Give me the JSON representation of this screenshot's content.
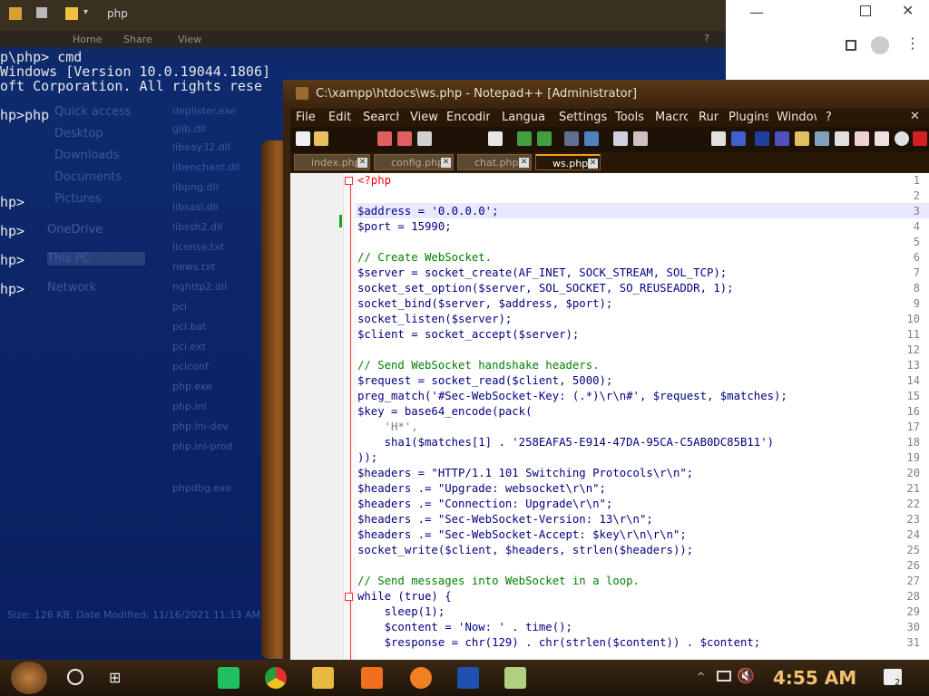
{
  "explorer": {
    "title": "php",
    "ribbon_tabs": [
      "Home",
      "Share",
      "View"
    ],
    "nav_items": [
      "Quick access",
      "Desktop",
      "Downloads",
      "Documents",
      "Pictures",
      "OneDrive",
      "This PC",
      "Network"
    ],
    "files": [
      "deplister.exe",
      "glib.dll",
      "libeay32.dll",
      "libenchant.dll",
      "libpng.dll",
      "libsasl.dll",
      "libssh2.dll",
      "license.txt",
      "news.txt",
      "nghttp2.dll",
      "pci",
      "pci.bat",
      "pci.ext",
      "pciconf",
      "php.exe",
      "php.ini",
      "php.ini-dev",
      "php.ini-prod",
      "phpdbg.exe"
    ],
    "status": "Size: 126 KB, Date Modified: 11/16/2021 11:13 AM"
  },
  "cmd": {
    "lines": [
      "p\\php> cmd",
      "Windows [Version 10.0.19044.1806]",
      "oft Corporation. All rights rese",
      "",
      "hp>php",
      "",
      "",
      "hp>",
      "",
      "hp>",
      "",
      "hp>",
      "",
      "hp>"
    ]
  },
  "npp": {
    "title": "C:\\xampp\\htdocs\\ws.php - Notepad++ [Administrator]",
    "menu": [
      "File",
      "Edit",
      "Search",
      "View",
      "Encoding",
      "Language",
      "Settings",
      "Tools",
      "Macro",
      "Run",
      "Plugins",
      "Window",
      "?"
    ],
    "tabs": [
      "index.php",
      "config.php",
      "chat.php",
      "ws.php"
    ],
    "line_numbers": [
      "1",
      "2",
      "3",
      "4",
      "5",
      "6",
      "7",
      "8",
      "9",
      "10",
      "11",
      "12",
      "13",
      "14",
      "15",
      "16",
      "17",
      "18",
      "19",
      "20",
      "21",
      "22",
      "23",
      "24",
      "25",
      "26",
      "27",
      "28",
      "29",
      "30",
      "31"
    ],
    "code_lines": [
      "<?php",
      "",
      "$address = '0.0.0.0';",
      "$port = 15990;",
      "",
      "// Create WebSocket.",
      "$server = socket_create(AF_INET, SOCK_STREAM, SOL_TCP);",
      "socket_set_option($server, SOL_SOCKET, SO_REUSEADDR, 1);",
      "socket_bind($server, $address, $port);",
      "socket_listen($server);",
      "$client = socket_accept($server);",
      "",
      "// Send WebSocket handshake headers.",
      "$request = socket_read($client, 5000);",
      "preg_match('#Sec-WebSocket-Key: (.*)\\r\\n#', $request, $matches);",
      "$key = base64_encode(pack(",
      "    'H*',",
      "    sha1($matches[1] . '258EAFA5-E914-47DA-95CA-C5AB0DC85B11')",
      "));",
      "$headers = \"HTTP/1.1 101 Switching Protocols\\r\\n\";",
      "$headers .= \"Upgrade: websocket\\r\\n\";",
      "$headers .= \"Connection: Upgrade\\r\\n\";",
      "$headers .= \"Sec-WebSocket-Version: 13\\r\\n\";",
      "$headers .= \"Sec-WebSocket-Accept: $key\\r\\n\\r\\n\";",
      "socket_write($client, $headers, strlen($headers));",
      "",
      "// Send messages into WebSocket in a loop.",
      "while (true) {",
      "    sleep(1);",
      "    $content = 'Now: ' . time();",
      "    $response = chr(129) . chr(strlen($content)) . $content;"
    ]
  },
  "taskbar": {
    "clock": "4:55 AM",
    "notification_count": "2"
  },
  "colors": {
    "keyword": "#000080",
    "string": "#808080",
    "number": "#ff8000",
    "comment": "#008000",
    "php_tag": "#ff0000"
  }
}
